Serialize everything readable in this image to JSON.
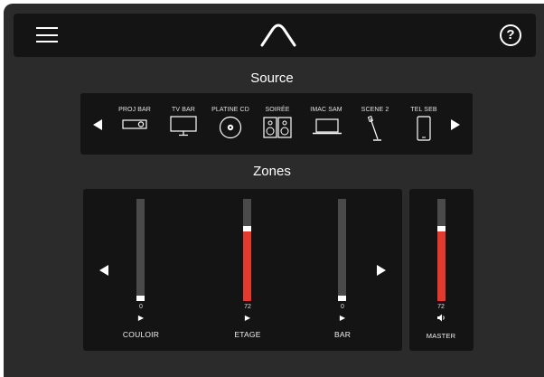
{
  "header": {
    "menu_icon": "hamburger-menu-icon",
    "logo_icon": "caret-logo-icon",
    "help_label": "?"
  },
  "source": {
    "title": "Source",
    "items": [
      {
        "label": "PROJ BAR",
        "icon": "projector-icon"
      },
      {
        "label": "TV BAR",
        "icon": "tv-icon"
      },
      {
        "label": "PLATINE CD",
        "icon": "cd-icon"
      },
      {
        "label": "SOIRÉE",
        "icon": "speakers-icon"
      },
      {
        "label": "IMAC SAM",
        "icon": "laptop-icon"
      },
      {
        "label": "SCENE 2",
        "icon": "microphone-icon"
      },
      {
        "label": "TEL SEB",
        "icon": "phone-icon"
      }
    ]
  },
  "zones": {
    "title": "Zones",
    "items": [
      {
        "name": "COULOIR",
        "value": "0",
        "level": 0,
        "play": "▶"
      },
      {
        "name": "ETAGE",
        "value": "72",
        "level": 0.72,
        "play": "▶"
      },
      {
        "name": "BAR",
        "value": "0",
        "level": 0,
        "play": "▶"
      }
    ],
    "master": {
      "name": "MASTER",
      "value": "72",
      "level": 0.72,
      "icon": "speaker-volume-icon"
    }
  },
  "colors": {
    "background": "#2b2b2b",
    "panel": "#141414",
    "level_fill": "#e23b2e",
    "track": "#4a4a4a"
  }
}
